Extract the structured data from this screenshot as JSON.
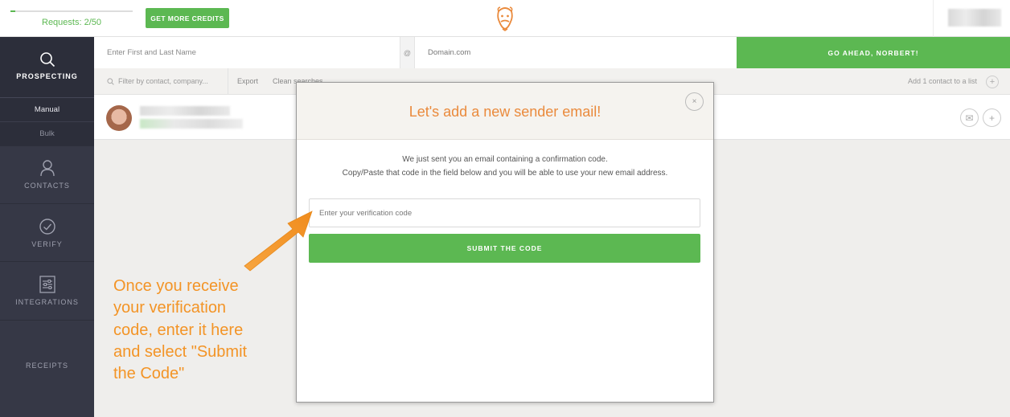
{
  "topbar": {
    "requests_label": "Requests: 2/50",
    "requests_progress": 0.04,
    "credits_button": "GET MORE CREDITS",
    "logo_icon": "norbert-face-logo-icon"
  },
  "sidebar": {
    "prospecting": "PROSPECTING",
    "manual": "Manual",
    "bulk": "Bulk",
    "contacts": "CONTACTS",
    "verify": "VERIFY",
    "integrations": "INTEGRATIONS",
    "receipts": "RECEIPTS"
  },
  "search": {
    "name_placeholder": "Enter First and Last Name",
    "at_symbol": "@",
    "domain_placeholder": "Domain.com",
    "go_button": "GO AHEAD, NORBERT!"
  },
  "filter": {
    "placeholder": "Filter by contact, company...",
    "export": "Export",
    "clean": "Clean searches",
    "add_to_list": "Add 1 contact to a list",
    "add_icon": "+"
  },
  "contact_row": {
    "mail_icon": "✉",
    "add_icon": "+"
  },
  "modal": {
    "title": "Let's add a new sender email!",
    "close_icon": "×",
    "message_line1": "We just sent you an email containing a confirmation code.",
    "message_line2": "Copy/Paste that code in the field below and you will be able to use your new email address.",
    "code_placeholder": "Enter your verification code",
    "submit_button": "SUBMIT THE CODE"
  },
  "annotation": {
    "line1": "Once you receive",
    "line2": "your verification",
    "line3": "code, enter it here",
    "line4": "and select \"Submit",
    "line5": "the Code\""
  },
  "colors": {
    "green": "#5cb852",
    "orange": "#ea8a3c",
    "annotation_orange": "#f39426",
    "sidebar": "#363846"
  }
}
